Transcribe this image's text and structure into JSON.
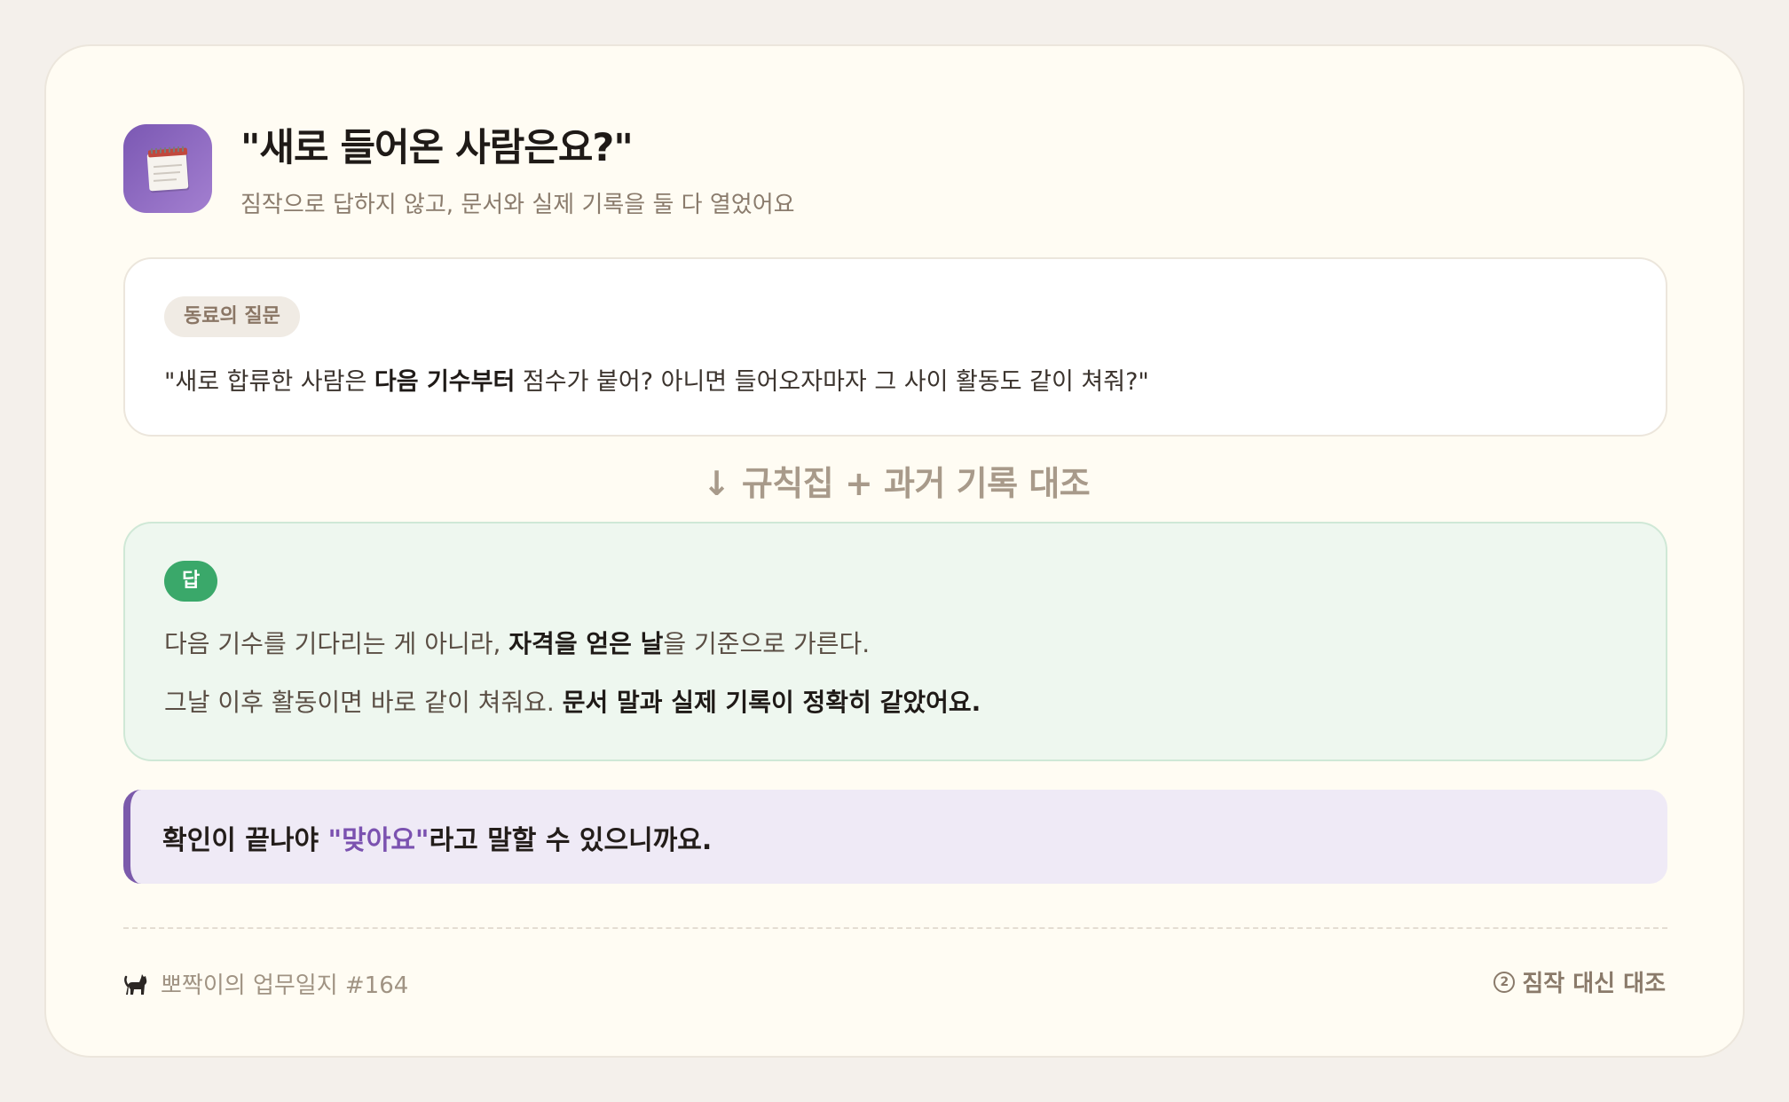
{
  "header": {
    "icon": "spiral-notepad-icon",
    "title": "\"새로 들어온 사람은요?\"",
    "subtitle": "짐작으로 답하지 않고, 문서와 실제 기록을 둘 다 열었어요"
  },
  "question": {
    "badge": "동료의 질문",
    "text_pre": "\"새로 합류한 사람은 ",
    "text_bold": "다음 기수부터",
    "text_post": " 점수가 붙어? 아니면 들어오자마자 그 사이 활동도 같이 쳐줘?\""
  },
  "divider": {
    "label": "↓ 규칙집 + 과거 기록 대조"
  },
  "answer": {
    "badge": "답",
    "line1_pre": "다음 기수를 기다리는 게 아니라, ",
    "line1_bold": "자격을 얻은 날",
    "line1_post": "을 기준으로 가른다.",
    "line2_pre": "그날 이후 활동이면 바로 같이 쳐줘요. ",
    "line2_bold": "문서 말과 실제 기록이 정확히 같았어요."
  },
  "note": {
    "pre": "확인이 끝나야 ",
    "highlight": "\"맞아요\"",
    "post": "라고 말할 수 있으니까요."
  },
  "footer": {
    "left_icon": "black-cat-icon",
    "left_text": "뽀짝이의 업무일지 #164",
    "right_number": "2",
    "right_text": "짐작 대신 대조"
  },
  "colors": {
    "background": "#f4f0eb",
    "card": "#fffcf3",
    "accent_purple": "#7b5aab",
    "answer_green": "#3aa86a"
  }
}
